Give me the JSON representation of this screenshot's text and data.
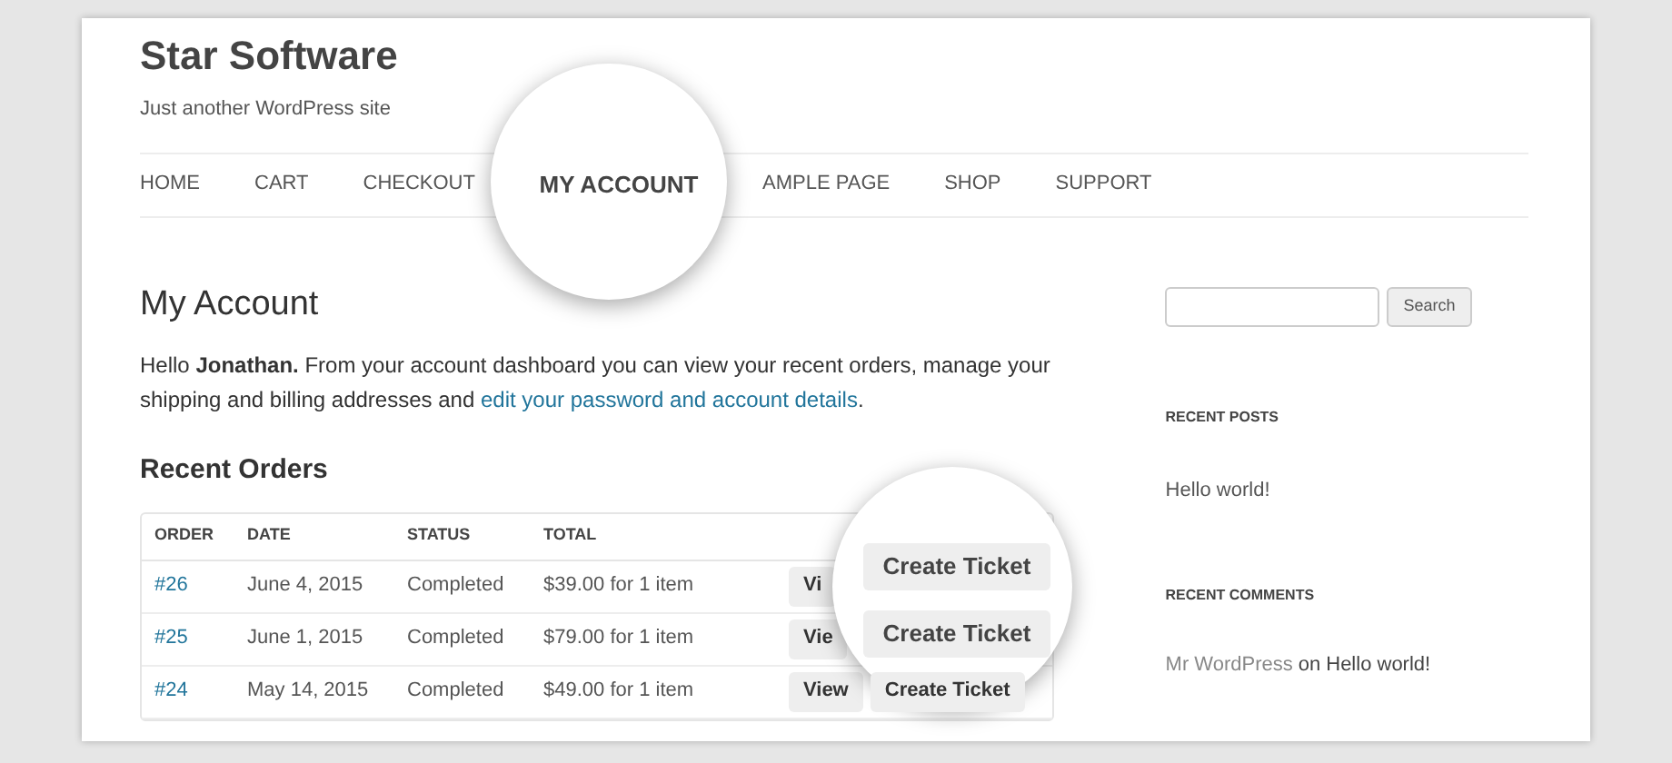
{
  "site": {
    "title": "Star Software",
    "tagline": "Just another WordPress site"
  },
  "nav": [
    {
      "label": "HOME",
      "selected": false,
      "magnified": false
    },
    {
      "label": "CART",
      "selected": false,
      "magnified": false
    },
    {
      "label": "CHECKOUT",
      "selected": false,
      "magnified": false
    },
    {
      "label": "MY ACCOUNT",
      "selected": true,
      "magnified": true
    },
    {
      "label": "AMPLE PAGE",
      "selected": false,
      "magnified": false
    },
    {
      "label": "SHOP",
      "selected": false,
      "magnified": false
    },
    {
      "label": "SUPPORT",
      "selected": false,
      "magnified": false
    }
  ],
  "page": {
    "title": "My Account",
    "greeting": "Hello **Jonathan.** From your account dashboard you can view your recent orders, manage your shipping and billing addresses and",
    "link": "edit your password and account details",
    "after_link": "."
  },
  "orders": {
    "title": "Recent Orders",
    "columns": [
      "ORDER",
      "DATE",
      "STATUS",
      "TOTAL"
    ],
    "rows": [
      {
        "order": "#26",
        "date": "June 4, 2015",
        "status": "Completed",
        "total": "$39.00 for 1 item",
        "view": "Vi",
        "ticket": "Create Ticket",
        "magnified": true
      },
      {
        "order": "#25",
        "date": "June 1, 2015",
        "status": "Completed",
        "total": "$79.00 for 1 item",
        "view": "Vie",
        "ticket": "Create Ticket",
        "magnified": true
      },
      {
        "order": "#24",
        "date": "May 14, 2015",
        "status": "Completed",
        "total": "$49.00 for 1 item",
        "view": "View",
        "ticket": "Create Ticket",
        "magnified": false
      }
    ]
  },
  "sidebar": {
    "search_button": "Search",
    "recent_posts": {
      "title": "RECENT POSTS",
      "items": [
        "Hello world!"
      ]
    },
    "recent_comments": {
      "title": "RECENT COMMENTS",
      "items": [
        {
          "author": "Mr WordPress",
          "on": "on",
          "post": "Hello world!"
        }
      ]
    }
  }
}
